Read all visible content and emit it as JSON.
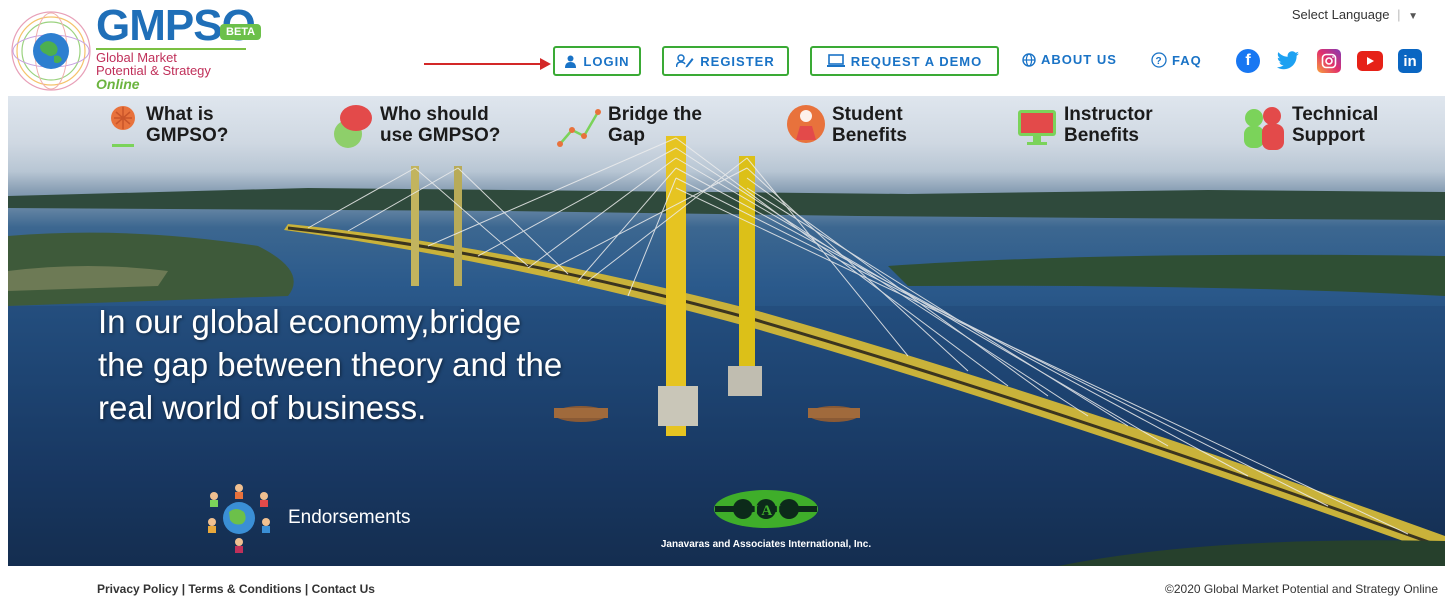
{
  "brand": {
    "wordmark": "GMPSO",
    "beta_badge": "BETA",
    "tagline_line1": "Global Market",
    "tagline_line2": "Potential & Strategy",
    "tagline_line3": "Online"
  },
  "language": {
    "label": "Select Language",
    "separator": "|",
    "arrow": "▼"
  },
  "nav": {
    "login": "LOGIN",
    "register": "REGISTER",
    "request_demo": "REQUEST A DEMO",
    "about_us": "ABOUT US",
    "faq": "FAQ"
  },
  "social": [
    {
      "name": "facebook-icon",
      "color": "#1877f2",
      "glyph": "f"
    },
    {
      "name": "twitter-icon",
      "color": "#1da1f2",
      "glyph": "🐦"
    },
    {
      "name": "instagram-icon",
      "color": "#c13584",
      "glyph": "◎"
    },
    {
      "name": "youtube-icon",
      "color": "#e62117",
      "glyph": "▶"
    },
    {
      "name": "linkedin-icon",
      "color": "#0a66c2",
      "glyph": "in"
    }
  ],
  "features": [
    {
      "line1": "What is",
      "line2": "GMPSO?",
      "icon": "globe-trophy-icon"
    },
    {
      "line1": "Who should",
      "line2": "use GMPSO?",
      "icon": "user-question-icon"
    },
    {
      "line1": "Bridge the",
      "line2": "Gap",
      "icon": "trend-line-icon"
    },
    {
      "line1": "Student",
      "line2": "Benefits",
      "icon": "student-icon"
    },
    {
      "line1": "Instructor",
      "line2": "Benefits",
      "icon": "monitor-icon"
    },
    {
      "line1": "Technical",
      "line2": "Support",
      "icon": "support-people-icon"
    }
  ],
  "hero": {
    "headline_line1": "In our global economy,bridge",
    "headline_line2": "the gap between theory and the",
    "headline_line3": "real world of business."
  },
  "endorsements": {
    "label": "Endorsements"
  },
  "partner": {
    "logo_letters": "J  A  I",
    "name": "Janavaras and Associates International, Inc."
  },
  "footer": {
    "privacy": "Privacy Policy",
    "terms": "Terms & Conditions",
    "contact": "Contact Us",
    "separator": " | ",
    "copyright": "©2020 Global Market Potential and Strategy Online"
  },
  "colors": {
    "brand_blue": "#1a73c6",
    "button_border_green": "#3aaa35",
    "annotation_arrow": "#d32828"
  }
}
